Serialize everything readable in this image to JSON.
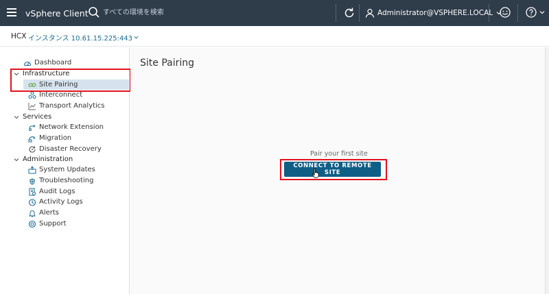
{
  "header": {
    "app_title": "vSphere Client",
    "search_placeholder": "すべての環境を検索",
    "user": "Administrator@VSPHERE.LOCAL",
    "icons": [
      "menu-icon",
      "search-icon",
      "refresh-icon",
      "user-icon",
      "smiley-icon",
      "help-icon"
    ]
  },
  "subheader": {
    "product": "HCX",
    "instance": "インスタンス 10.61.15.225:443"
  },
  "sidebar": {
    "items": [
      {
        "label": "Dashboard",
        "icon": "dashboard-icon",
        "type": "item"
      },
      {
        "label": "Infrastructure",
        "type": "group"
      },
      {
        "label": "Site Pairing",
        "icon": "site-pairing-icon",
        "type": "item",
        "selected": true
      },
      {
        "label": "Interconnect",
        "icon": "interconnect-icon",
        "type": "item"
      },
      {
        "label": "Transport Analytics",
        "icon": "analytics-icon",
        "type": "item"
      },
      {
        "label": "Services",
        "type": "group"
      },
      {
        "label": "Network Extension",
        "icon": "network-extension-icon",
        "type": "item"
      },
      {
        "label": "Migration",
        "icon": "migration-icon",
        "type": "item"
      },
      {
        "label": "Disaster Recovery",
        "icon": "disaster-recovery-icon",
        "type": "item"
      },
      {
        "label": "Administration",
        "type": "group"
      },
      {
        "label": "System Updates",
        "icon": "system-updates-icon",
        "type": "item"
      },
      {
        "label": "Troubleshooting",
        "icon": "troubleshooting-icon",
        "type": "item"
      },
      {
        "label": "Audit Logs",
        "icon": "audit-logs-icon",
        "type": "item"
      },
      {
        "label": "Activity Logs",
        "icon": "activity-logs-icon",
        "type": "item"
      },
      {
        "label": "Alerts",
        "icon": "alerts-icon",
        "type": "item"
      },
      {
        "label": "Support",
        "icon": "support-icon",
        "type": "item"
      }
    ]
  },
  "main": {
    "title": "Site Pairing",
    "hint": "Pair your first site",
    "button_label": "CONNECT TO REMOTE SITE"
  },
  "colors": {
    "header_bg": "#2f3c4a",
    "accent_button": "#0f5e86",
    "link": "#1c6a8f",
    "selection": "#d6e3ee",
    "highlight_box": "#e0131e"
  }
}
